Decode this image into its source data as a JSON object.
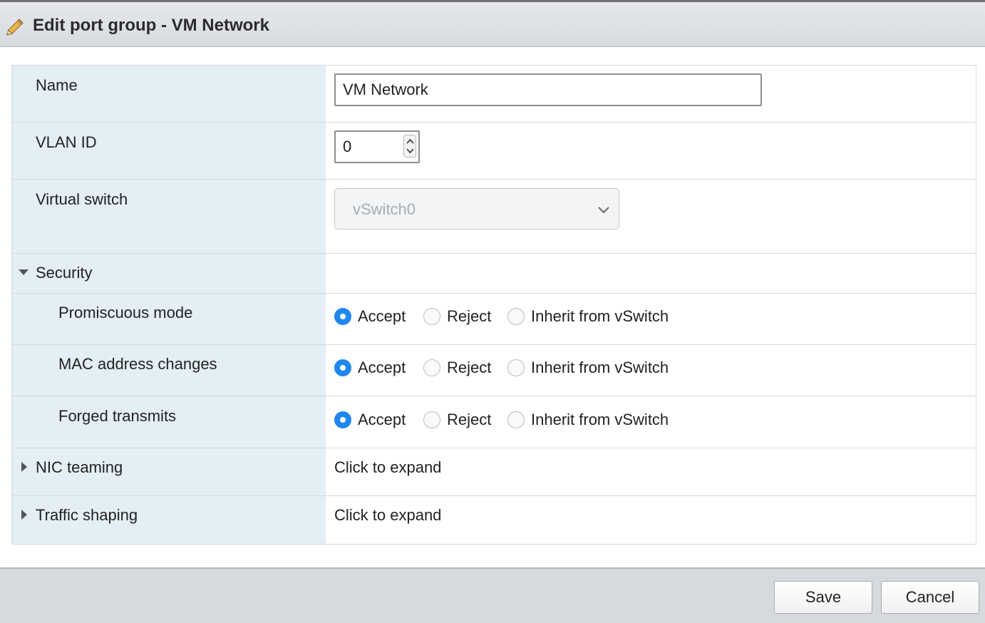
{
  "dialog": {
    "title": "Edit port group - VM Network",
    "title_icon": "pencil-icon"
  },
  "form": {
    "name": {
      "label": "Name",
      "value": "VM Network"
    },
    "vlan": {
      "label": "VLAN ID",
      "value": "0"
    },
    "vswitch": {
      "label": "Virtual switch",
      "value": "vSwitch0",
      "disabled": true
    },
    "security": {
      "label": "Security",
      "expanded": true,
      "options": [
        "Accept",
        "Reject",
        "Inherit from vSwitch"
      ],
      "rows": [
        {
          "label": "Promiscuous mode",
          "selected": "Accept"
        },
        {
          "label": "MAC address changes",
          "selected": "Accept"
        },
        {
          "label": "Forged transmits",
          "selected": "Accept"
        }
      ]
    },
    "nic_teaming": {
      "label": "NIC teaming",
      "value": "Click to expand"
    },
    "traffic_shaping": {
      "label": "Traffic shaping",
      "value": "Click to expand"
    }
  },
  "footer": {
    "save_label": "Save",
    "cancel_label": "Cancel"
  },
  "colors": {
    "label_bg": "#e4eef5",
    "radio_selected": "#1e87f0",
    "footer_bg": "#d6d9dd"
  }
}
